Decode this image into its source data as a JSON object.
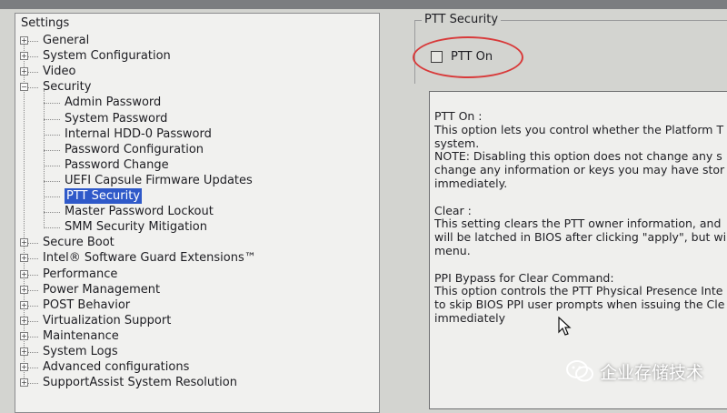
{
  "settings_title": "Settings",
  "tree": [
    {
      "label": "General",
      "level": 0,
      "expander": "+"
    },
    {
      "label": "System Configuration",
      "level": 0,
      "expander": "+"
    },
    {
      "label": "Video",
      "level": 0,
      "expander": "+"
    },
    {
      "label": "Security",
      "level": 0,
      "expander": "−"
    },
    {
      "label": "Admin Password",
      "level": 1
    },
    {
      "label": "System Password",
      "level": 1
    },
    {
      "label": "Internal HDD-0 Password",
      "level": 1
    },
    {
      "label": "Password Configuration",
      "level": 1
    },
    {
      "label": "Password Change",
      "level": 1
    },
    {
      "label": "UEFI Capsule Firmware Updates",
      "level": 1
    },
    {
      "label": "PTT Security",
      "level": 1,
      "selected": true
    },
    {
      "label": "Master Password Lockout",
      "level": 1
    },
    {
      "label": "SMM Security Mitigation",
      "level": 1
    },
    {
      "label": "Secure Boot",
      "level": 0,
      "expander": "+"
    },
    {
      "label": "Intel® Software Guard Extensions™",
      "level": 0,
      "expander": "+"
    },
    {
      "label": "Performance",
      "level": 0,
      "expander": "+"
    },
    {
      "label": "Power Management",
      "level": 0,
      "expander": "+"
    },
    {
      "label": "POST Behavior",
      "level": 0,
      "expander": "+"
    },
    {
      "label": "Virtualization Support",
      "level": 0,
      "expander": "+"
    },
    {
      "label": "Maintenance",
      "level": 0,
      "expander": "+"
    },
    {
      "label": "System Logs",
      "level": 0,
      "expander": "+"
    },
    {
      "label": "Advanced configurations",
      "level": 0,
      "expander": "+"
    },
    {
      "label": "SupportAssist System Resolution",
      "level": 0,
      "expander": "+"
    }
  ],
  "group_title": "PTT Security",
  "checkbox": {
    "label": "PTT On",
    "checked": false
  },
  "help_lines": [
    "PTT On :",
    "This option lets you control whether the Platform T",
    "system.",
    "NOTE: Disabling this option does not change any s",
    "change any information or keys you may have stor",
    "immediately.",
    "",
    "Clear :",
    "This setting clears the PTT owner information, and",
    "will be latched in BIOS after clicking \"apply\", but wi",
    "menu.",
    "",
    "PPI Bypass for Clear Command:",
    "This option controls the PTT Physical Presence Inte",
    "to skip BIOS PPI user prompts when issuing the Cle",
    "immediately"
  ],
  "watermark": "企业存储技术",
  "colors": {
    "selection": "#2f59c9",
    "highlight_ellipse": "#d83a3a"
  }
}
